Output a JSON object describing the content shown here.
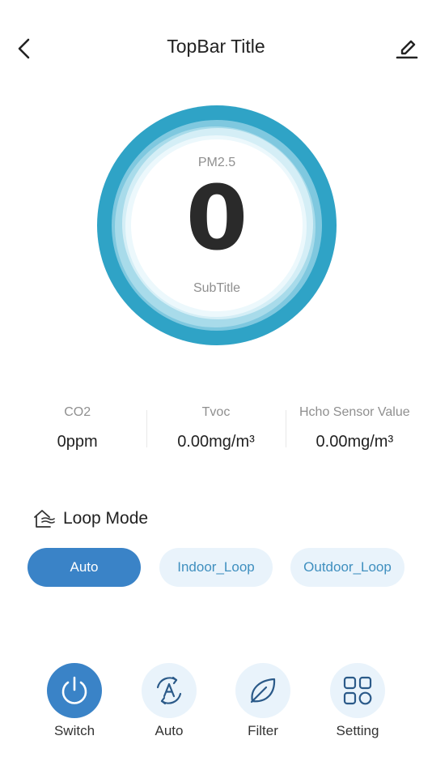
{
  "topbar": {
    "title": "TopBar Title"
  },
  "gauge": {
    "label": "PM2.5",
    "value": "0",
    "subtitle": "SubTitle"
  },
  "metrics": [
    {
      "label": "CO2",
      "value": "0ppm"
    },
    {
      "label": "Tvoc",
      "value": "0.00mg/m³"
    },
    {
      "label": "Hcho Sensor Value",
      "value": "0.00mg/m³"
    }
  ],
  "loop_mode": {
    "title": "Loop Mode",
    "options": [
      "Auto",
      "Indoor_Loop",
      "Outdoor_Loop"
    ],
    "selected": "Auto"
  },
  "bottom_bar": [
    {
      "label": "Switch",
      "icon": "power-icon"
    },
    {
      "label": "Auto",
      "icon": "auto-cycle-icon"
    },
    {
      "label": "Filter",
      "icon": "leaf-icon"
    },
    {
      "label": "Setting",
      "icon": "grid-icon"
    }
  ],
  "colors": {
    "accent": "#3a83c7",
    "ring": "#2fa3c6",
    "chip_bg": "#e9f3fb",
    "chip_text": "#3f8fbf"
  }
}
